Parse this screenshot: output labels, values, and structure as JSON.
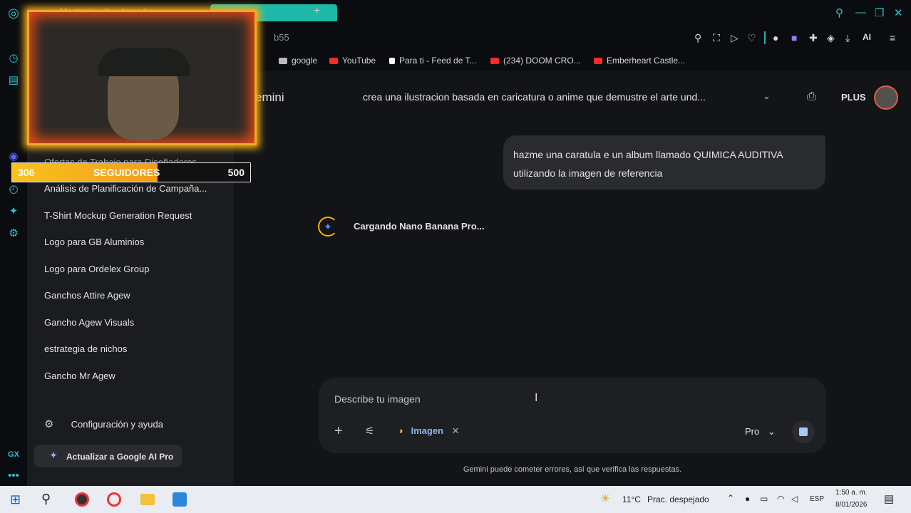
{
  "browser": {
    "url_fragment": "b55",
    "tab_partial": "Mostrar/ocultar dama toy",
    "bookmarks": [
      {
        "label": "google",
        "color": "#bbbbbb"
      },
      {
        "label": "YouTube",
        "color": "#ff2a2a"
      },
      {
        "label": "Para ti - Feed de T...",
        "color": "#ffffff"
      },
      {
        "label": "(234) DOOM CRO...",
        "color": "#ff2a2a"
      },
      {
        "label": "Emberheart Castle...",
        "color": "#ff2a2a"
      }
    ],
    "ai_label": "AI"
  },
  "gemini": {
    "brand_partial": "emini",
    "chat_title": "crea una ilustracion basada en caricatura o anime que demustre el arte und...",
    "plus_label": "PLUS",
    "sidebar_items": [
      "Ofertas de Trabajo para Diseñadores",
      "Análisis de Planificación de Campaña...",
      "T-Shirt Mockup Generation Request",
      "Logo para GB Aluminios",
      "Logo para Ordelex Group",
      "Ganchos Attire Agew",
      "Gancho Agew Visuals",
      "estrategia de nichos",
      "Gancho Mr Agew"
    ],
    "settings_label": "Configuración y ayuda",
    "upgrade_label": "Actualizar a Google AI Pro",
    "user_message": "hazme una caratula e un album llamado QUIMICA AUDITIVA utilizando la imagen de referencia",
    "loading_text": "Cargando Nano Banana Pro...",
    "composer": {
      "placeholder": "Describe tu imagen",
      "tool_chip": "Imagen",
      "model": "Pro"
    },
    "disclaimer": "Gemini puede cometer errores, así que verifica las respuestas."
  },
  "overlay": {
    "followers_current": "306",
    "followers_label": "SEGUIDORES",
    "followers_goal": "500",
    "progress": 0.612
  },
  "taskbar": {
    "weather": "11°C",
    "weather_desc": "Prac. despejado",
    "lang": "ESP",
    "time": "1:50 a. m.",
    "date": "8/01/2026"
  }
}
